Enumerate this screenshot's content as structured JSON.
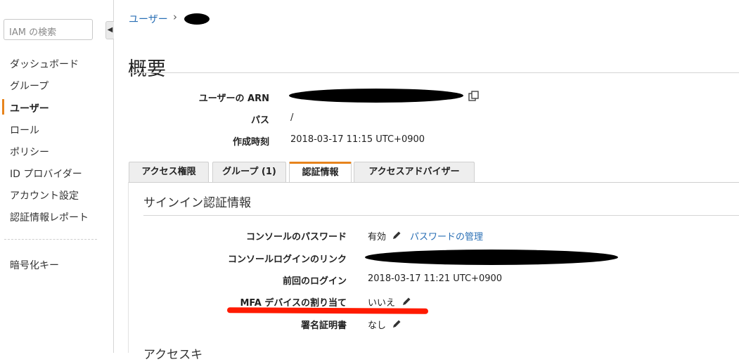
{
  "sidebar": {
    "search_placeholder": "IAM の検索",
    "collapse_icon": "◀",
    "items": [
      {
        "label": "ダッシュボード"
      },
      {
        "label": "グループ"
      },
      {
        "label": "ユーザー",
        "active": true
      },
      {
        "label": "ロール"
      },
      {
        "label": "ポリシー"
      },
      {
        "label": "ID プロバイダー"
      },
      {
        "label": "アカウント設定"
      },
      {
        "label": "認証情報レポート"
      }
    ],
    "bottom_items": [
      {
        "label": "暗号化キー"
      }
    ]
  },
  "breadcrumb": {
    "link": "ユーザー",
    "separator": "›",
    "current": "[redacted]"
  },
  "page_title": "概要",
  "summary": {
    "arn_label": "ユーザーの ARN",
    "arn_value": "[redacted]",
    "path_label": "パス",
    "path_value": "/",
    "created_label": "作成時刻",
    "created_value": "2018-03-17 11:15 UTC+0900"
  },
  "tabs": [
    {
      "label": "アクセス権限"
    },
    {
      "label": "グループ (1)"
    },
    {
      "label": "認証情報",
      "active": true
    },
    {
      "label": "アクセスアドバイザー"
    }
  ],
  "signin": {
    "title": "サインイン認証情報",
    "console_password_label": "コンソールのパスワード",
    "console_password_value": "有効",
    "manage_password_link": "パスワードの管理",
    "console_login_link_label": "コンソールログインのリンク",
    "console_login_link_value": "[redacted]",
    "last_login_label": "前回のログイン",
    "last_login_value": "2018-03-17 11:21 UTC+0900",
    "mfa_label": "MFA デバイスの割り当て",
    "mfa_value": "いいえ",
    "cert_label": "署名証明書",
    "cert_value": "なし"
  },
  "next_section_partial": "アクセスキ",
  "colors": {
    "accent": "#e7841d",
    "link": "#2a6fb5",
    "annotation": "#ff1a00"
  }
}
